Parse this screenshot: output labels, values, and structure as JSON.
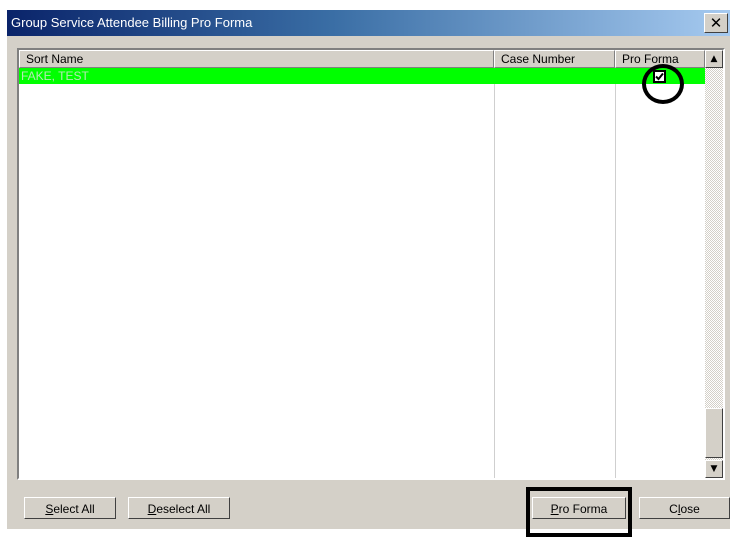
{
  "window": {
    "title": "Group Service Attendee Billing Pro Forma",
    "close_label": "✕"
  },
  "list": {
    "columns": [
      "Sort Name",
      "Case Number",
      "Pro Forma"
    ],
    "rows": [
      {
        "sort_name": "FAKE, TEST",
        "case_number": "",
        "pro_forma_checked": true,
        "selected": true
      }
    ],
    "row_highlight_color": "#00ff00"
  },
  "scrollbar": {
    "up_icon": "▲",
    "down_icon": "▼"
  },
  "buttons": {
    "select_all": {
      "mnemonic": "S",
      "rest": "elect All"
    },
    "deselect_all": {
      "mnemonic": "D",
      "rest": "eselect All"
    },
    "pro_forma": {
      "mnemonic": "P",
      "rest": "ro Forma"
    },
    "close": {
      "pre": "C",
      "mnemonic": "l",
      "rest": "ose"
    }
  },
  "annotations": {
    "color": "#000000",
    "marks": [
      "circle-around-pro-forma-checkbox",
      "rectangle-around-pro-forma-button"
    ]
  }
}
